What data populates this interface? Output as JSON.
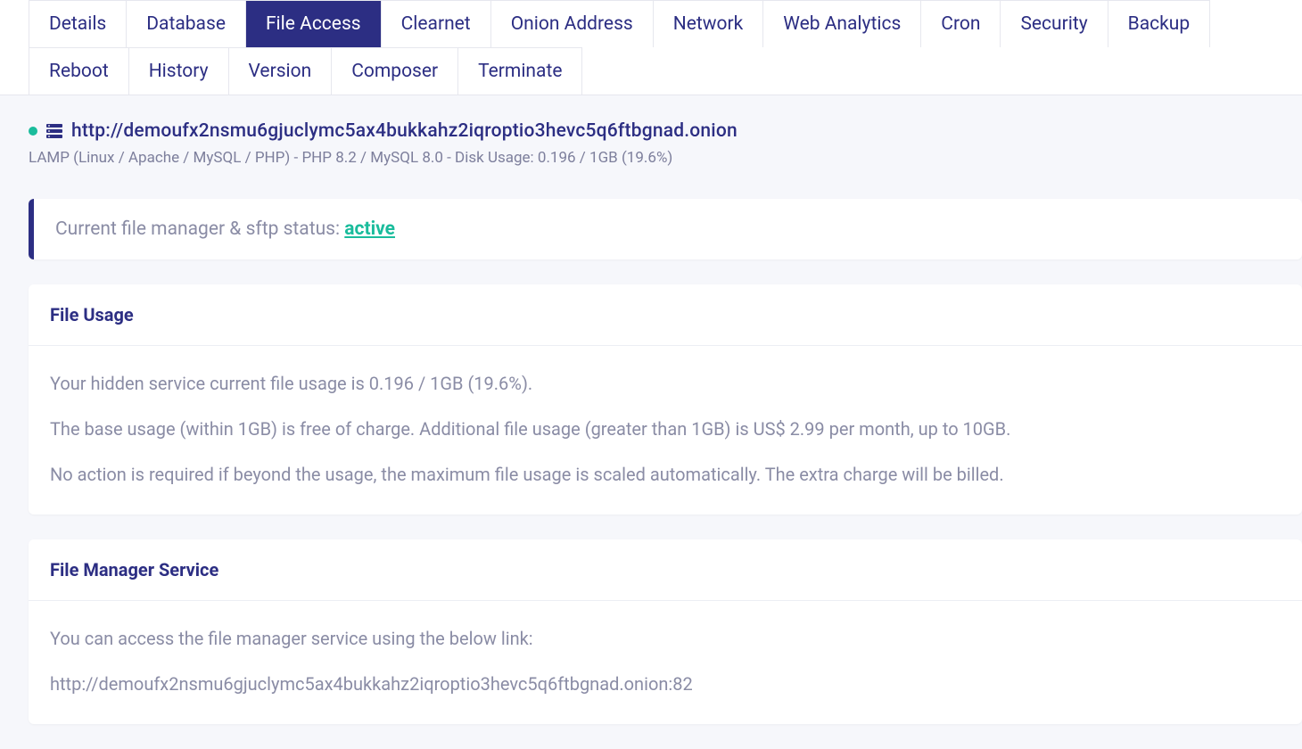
{
  "tabs": {
    "items": [
      "Details",
      "Database",
      "File Access",
      "Clearnet",
      "Onion Address",
      "Network",
      "Web Analytics",
      "Cron",
      "Security",
      "Backup",
      "Reboot",
      "History",
      "Version",
      "Composer",
      "Terminate"
    ],
    "active_index": 2
  },
  "host": {
    "url": "http://demoufx2nsmu6gjuclymc5ax4bukkahz2iqroptio3hevc5q6ftbgnad.onion",
    "meta": "LAMP (Linux / Apache / MySQL / PHP) - PHP 8.2 / MySQL 8.0 - Disk Usage: 0.196 / 1GB (19.6%)"
  },
  "status_card": {
    "prefix": "Current file manager & sftp status: ",
    "value": "active"
  },
  "file_usage": {
    "title": "File Usage",
    "p1": "Your hidden service current file usage is 0.196 / 1GB (19.6%).",
    "p2": "The base usage (within 1GB) is free of charge. Additional file usage (greater than 1GB) is US$ 2.99 per month, up to 10GB.",
    "p3": "No action is required if beyond the usage, the maximum file usage is scaled automatically. The extra charge will be billed."
  },
  "file_manager": {
    "title": "File Manager Service",
    "intro": "You can access the file manager service using the below link:",
    "link": "http://demoufx2nsmu6gjuclymc5ax4bukkahz2iqroptio3hevc5q6ftbgnad.onion:82"
  }
}
